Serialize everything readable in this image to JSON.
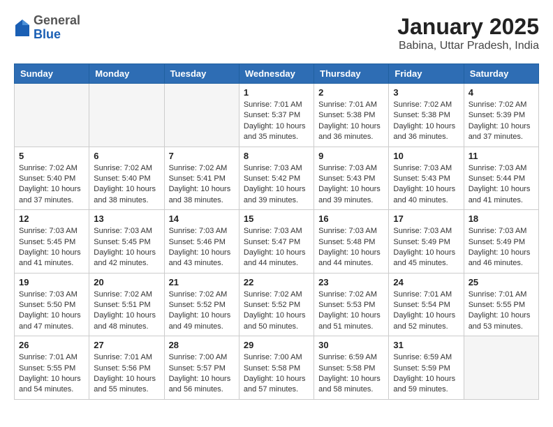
{
  "header": {
    "logo": {
      "general": "General",
      "blue": "Blue"
    },
    "title": "January 2025",
    "subtitle": "Babina, Uttar Pradesh, India"
  },
  "days_of_week": [
    "Sunday",
    "Monday",
    "Tuesday",
    "Wednesday",
    "Thursday",
    "Friday",
    "Saturday"
  ],
  "weeks": [
    [
      {
        "day": "",
        "info": ""
      },
      {
        "day": "",
        "info": ""
      },
      {
        "day": "",
        "info": ""
      },
      {
        "day": "1",
        "info": "Sunrise: 7:01 AM\nSunset: 5:37 PM\nDaylight: 10 hours\nand 35 minutes."
      },
      {
        "day": "2",
        "info": "Sunrise: 7:01 AM\nSunset: 5:38 PM\nDaylight: 10 hours\nand 36 minutes."
      },
      {
        "day": "3",
        "info": "Sunrise: 7:02 AM\nSunset: 5:38 PM\nDaylight: 10 hours\nand 36 minutes."
      },
      {
        "day": "4",
        "info": "Sunrise: 7:02 AM\nSunset: 5:39 PM\nDaylight: 10 hours\nand 37 minutes."
      }
    ],
    [
      {
        "day": "5",
        "info": "Sunrise: 7:02 AM\nSunset: 5:40 PM\nDaylight: 10 hours\nand 37 minutes."
      },
      {
        "day": "6",
        "info": "Sunrise: 7:02 AM\nSunset: 5:40 PM\nDaylight: 10 hours\nand 38 minutes."
      },
      {
        "day": "7",
        "info": "Sunrise: 7:02 AM\nSunset: 5:41 PM\nDaylight: 10 hours\nand 38 minutes."
      },
      {
        "day": "8",
        "info": "Sunrise: 7:03 AM\nSunset: 5:42 PM\nDaylight: 10 hours\nand 39 minutes."
      },
      {
        "day": "9",
        "info": "Sunrise: 7:03 AM\nSunset: 5:43 PM\nDaylight: 10 hours\nand 39 minutes."
      },
      {
        "day": "10",
        "info": "Sunrise: 7:03 AM\nSunset: 5:43 PM\nDaylight: 10 hours\nand 40 minutes."
      },
      {
        "day": "11",
        "info": "Sunrise: 7:03 AM\nSunset: 5:44 PM\nDaylight: 10 hours\nand 41 minutes."
      }
    ],
    [
      {
        "day": "12",
        "info": "Sunrise: 7:03 AM\nSunset: 5:45 PM\nDaylight: 10 hours\nand 41 minutes."
      },
      {
        "day": "13",
        "info": "Sunrise: 7:03 AM\nSunset: 5:45 PM\nDaylight: 10 hours\nand 42 minutes."
      },
      {
        "day": "14",
        "info": "Sunrise: 7:03 AM\nSunset: 5:46 PM\nDaylight: 10 hours\nand 43 minutes."
      },
      {
        "day": "15",
        "info": "Sunrise: 7:03 AM\nSunset: 5:47 PM\nDaylight: 10 hours\nand 44 minutes."
      },
      {
        "day": "16",
        "info": "Sunrise: 7:03 AM\nSunset: 5:48 PM\nDaylight: 10 hours\nand 44 minutes."
      },
      {
        "day": "17",
        "info": "Sunrise: 7:03 AM\nSunset: 5:49 PM\nDaylight: 10 hours\nand 45 minutes."
      },
      {
        "day": "18",
        "info": "Sunrise: 7:03 AM\nSunset: 5:49 PM\nDaylight: 10 hours\nand 46 minutes."
      }
    ],
    [
      {
        "day": "19",
        "info": "Sunrise: 7:03 AM\nSunset: 5:50 PM\nDaylight: 10 hours\nand 47 minutes."
      },
      {
        "day": "20",
        "info": "Sunrise: 7:02 AM\nSunset: 5:51 PM\nDaylight: 10 hours\nand 48 minutes."
      },
      {
        "day": "21",
        "info": "Sunrise: 7:02 AM\nSunset: 5:52 PM\nDaylight: 10 hours\nand 49 minutes."
      },
      {
        "day": "22",
        "info": "Sunrise: 7:02 AM\nSunset: 5:52 PM\nDaylight: 10 hours\nand 50 minutes."
      },
      {
        "day": "23",
        "info": "Sunrise: 7:02 AM\nSunset: 5:53 PM\nDaylight: 10 hours\nand 51 minutes."
      },
      {
        "day": "24",
        "info": "Sunrise: 7:01 AM\nSunset: 5:54 PM\nDaylight: 10 hours\nand 52 minutes."
      },
      {
        "day": "25",
        "info": "Sunrise: 7:01 AM\nSunset: 5:55 PM\nDaylight: 10 hours\nand 53 minutes."
      }
    ],
    [
      {
        "day": "26",
        "info": "Sunrise: 7:01 AM\nSunset: 5:55 PM\nDaylight: 10 hours\nand 54 minutes."
      },
      {
        "day": "27",
        "info": "Sunrise: 7:01 AM\nSunset: 5:56 PM\nDaylight: 10 hours\nand 55 minutes."
      },
      {
        "day": "28",
        "info": "Sunrise: 7:00 AM\nSunset: 5:57 PM\nDaylight: 10 hours\nand 56 minutes."
      },
      {
        "day": "29",
        "info": "Sunrise: 7:00 AM\nSunset: 5:58 PM\nDaylight: 10 hours\nand 57 minutes."
      },
      {
        "day": "30",
        "info": "Sunrise: 6:59 AM\nSunset: 5:58 PM\nDaylight: 10 hours\nand 58 minutes."
      },
      {
        "day": "31",
        "info": "Sunrise: 6:59 AM\nSunset: 5:59 PM\nDaylight: 10 hours\nand 59 minutes."
      },
      {
        "day": "",
        "info": ""
      }
    ]
  ]
}
